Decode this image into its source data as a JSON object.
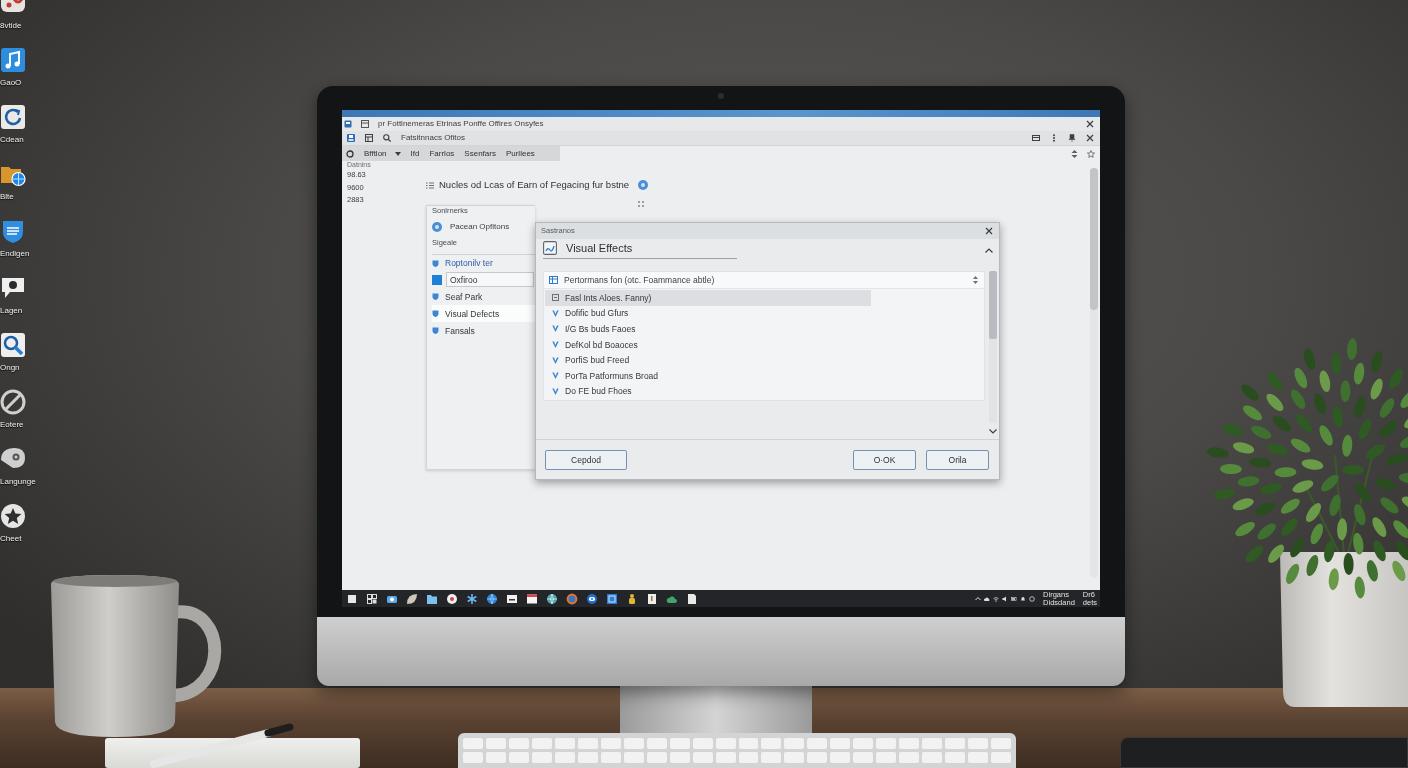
{
  "desktop_icons": [
    {
      "label": "8vtide"
    },
    {
      "label": "GaoO"
    },
    {
      "label": "Cdean"
    },
    {
      "label": "Blte"
    },
    {
      "label": "Endigen"
    },
    {
      "label": "Lagen"
    },
    {
      "label": "Ongn"
    },
    {
      "label": "Eotere"
    },
    {
      "label": "Langunge"
    },
    {
      "label": "Cheet"
    }
  ],
  "window": {
    "title": "pr Fottlnemeras Etrinas Ponffe Offires Onsyfes",
    "address": "Fatsitnnacs Ofitos",
    "menu": [
      {
        "label": "Bfftlon",
        "kind": "dropdown"
      },
      {
        "label": "Ifd",
        "kind": "plain"
      },
      {
        "label": "Farrlos",
        "kind": "plain"
      },
      {
        "label": "Ssenfars",
        "kind": "plain"
      },
      {
        "label": "Purllees",
        "kind": "plain"
      }
    ]
  },
  "stats": {
    "caption": "Datnins",
    "values": [
      "98.63",
      "9600",
      "2883"
    ]
  },
  "heading": "Nucles od Lcas of Earn of Fegacing fur bstne",
  "panel": {
    "title": "Sonlrnerks",
    "option": {
      "label": "Pacean Opfitons",
      "selected": true
    },
    "section": "Sigeale",
    "items": [
      {
        "label": "Roptonilv ter",
        "kind": "link",
        "selected": false
      },
      {
        "value": "Oxfiroo",
        "kind": "field"
      },
      {
        "label": "Seaf Park",
        "kind": "item",
        "selected": false
      },
      {
        "label": "Visual Defects",
        "kind": "item",
        "selected": true
      },
      {
        "label": "Fansals",
        "kind": "item",
        "selected": false
      }
    ]
  },
  "dialog": {
    "title": "Sastranos",
    "heading": "Visual Effects",
    "list": {
      "header": "Pertormans fon (otc. Foammance abtle)",
      "rows": [
        {
          "label": "Fasl Ints Aloes. Fanny)",
          "kind": "group",
          "selected": true
        },
        {
          "label": "Dofific bud Gfurs",
          "kind": "option",
          "selected": false
        },
        {
          "label": "I/G Bs buds Faoes",
          "kind": "option",
          "selected": false
        },
        {
          "label": "DefKol bd Boaoces",
          "kind": "option",
          "selected": false
        },
        {
          "label": "PorfiS bud Freed",
          "kind": "option",
          "selected": false
        },
        {
          "label": "PorTa Patformuns Broad",
          "kind": "option",
          "selected": false
        },
        {
          "label": "Do FE bud Fhoes",
          "kind": "option",
          "selected": false
        }
      ]
    },
    "buttons": [
      {
        "label": "Cepdod"
      },
      {
        "label": "O·OK"
      },
      {
        "label": "Orila"
      }
    ]
  },
  "taskbar": {
    "time_lines": [
      "Dirgans",
      "Didsdand"
    ],
    "date_lines": [
      "Dr6",
      "dets"
    ]
  }
}
